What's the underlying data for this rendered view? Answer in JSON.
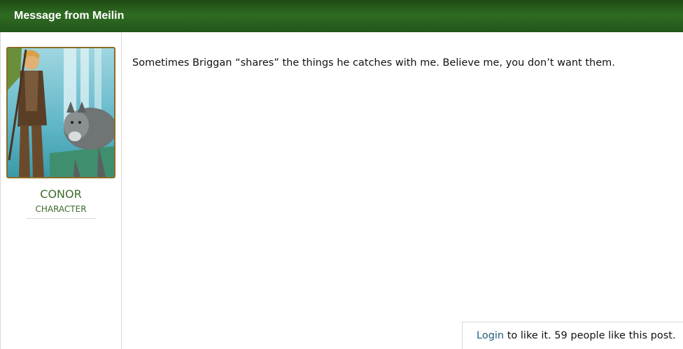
{
  "header": {
    "title": "Message from Meilin"
  },
  "author": {
    "avatar_icon": "character-portrait-icon",
    "name": "CONOR",
    "role": "CHARACTER"
  },
  "post": {
    "body": "Sometimes Briggan “shares” the things he catches with me. Believe me, you don’t want them."
  },
  "likes": {
    "login_label": "Login",
    "suffix": " to like it. 59 people like this post."
  },
  "colors": {
    "header_bg": "#2e6b22",
    "name_green": "#3d6b2a",
    "link_blue": "#1f5c7a"
  }
}
